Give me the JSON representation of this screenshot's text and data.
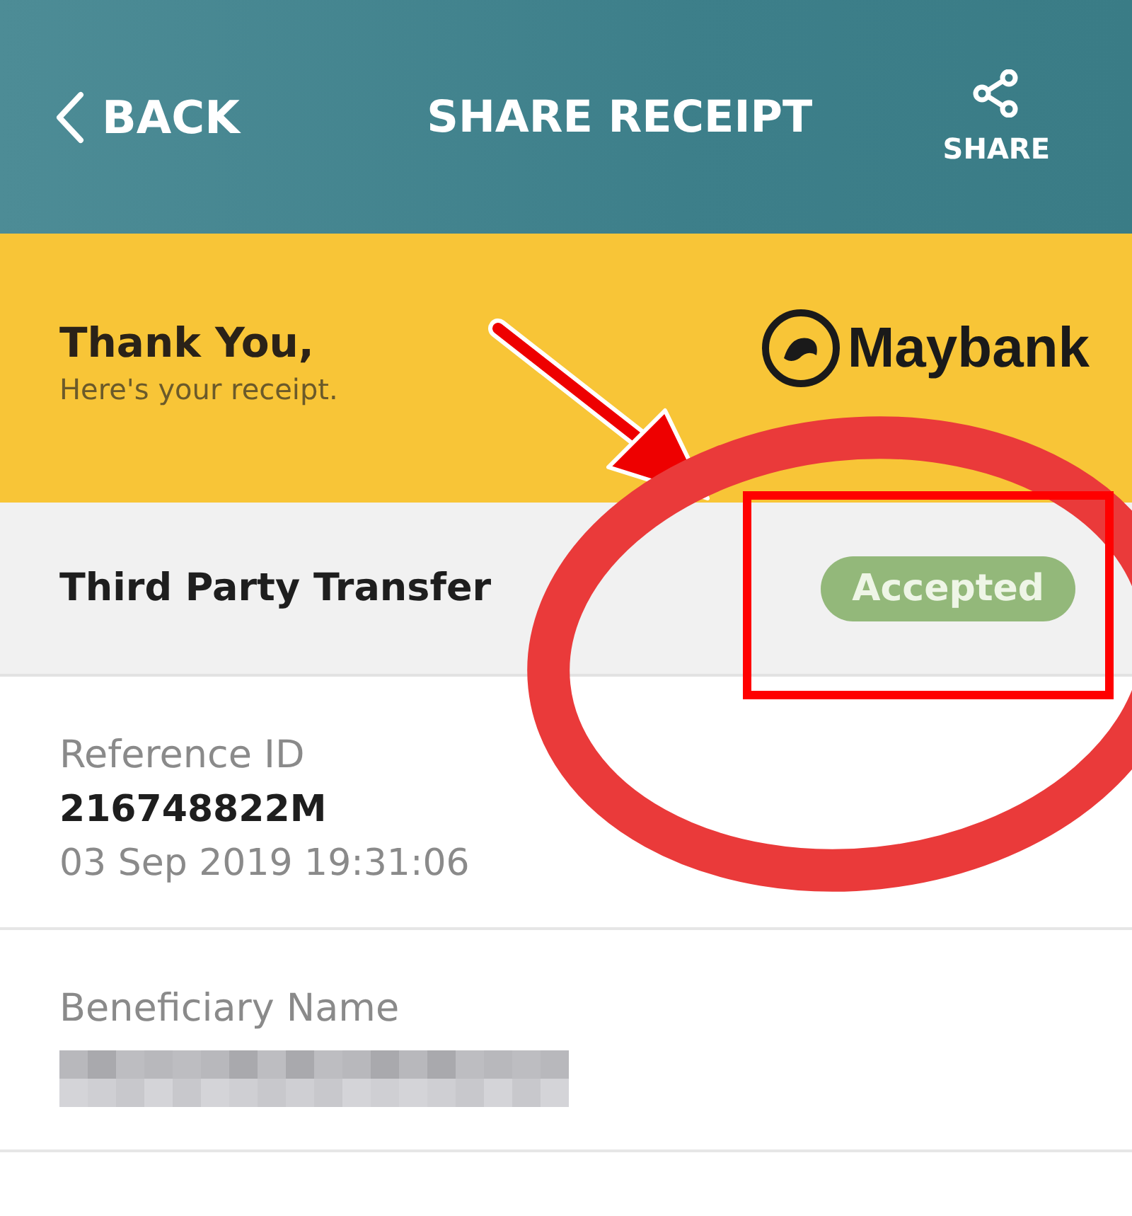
{
  "header": {
    "back_label": "BACK",
    "title": "SHARE RECEIPT",
    "share_label": "SHARE"
  },
  "banner": {
    "heading": "Thank You,",
    "subheading": "Here's your receipt.",
    "logo_text": "Maybank"
  },
  "transaction": {
    "type": "Third Party Transfer",
    "status": {
      "label": "Accepted",
      "kind": "accepted"
    }
  },
  "details": [
    {
      "label": "Reference ID",
      "value": "216748822M",
      "timestamp": "03 Sep 2019 19:31:06",
      "redacted": false
    },
    {
      "label": "Beneficiary Name",
      "redacted": true
    }
  ],
  "annotations": [
    {
      "kind": "arrow"
    },
    {
      "kind": "circle"
    },
    {
      "kind": "rectangle"
    }
  ]
}
